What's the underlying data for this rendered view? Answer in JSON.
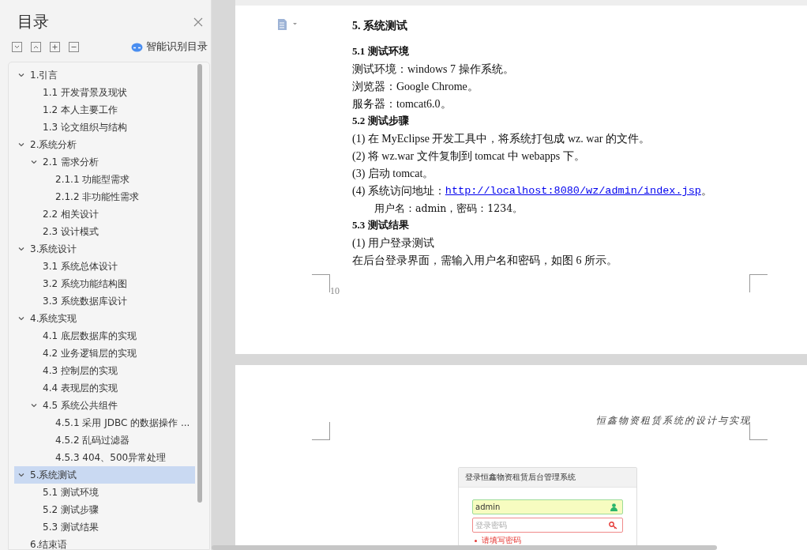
{
  "sidebar": {
    "title": "目录",
    "smart_toc": "智能识别目录",
    "tree": [
      {
        "label": "1.引言",
        "expanded": true,
        "selected": false,
        "children": [
          {
            "label": "1.1 开发背景及现状",
            "selected": false
          },
          {
            "label": "1.2 本人主要工作",
            "selected": false
          },
          {
            "label": "1.3 论文组织与结构",
            "selected": false
          }
        ]
      },
      {
        "label": "2.系统分析",
        "expanded": true,
        "selected": false,
        "children": [
          {
            "label": "2.1 需求分析",
            "expanded": true,
            "selected": false,
            "children": [
              {
                "label": "2.1.1 功能型需求",
                "selected": false
              },
              {
                "label": "2.1.2 非功能性需求",
                "selected": false
              }
            ]
          },
          {
            "label": "2.2 相关设计",
            "selected": false
          },
          {
            "label": "2.3 设计模式",
            "selected": false
          }
        ]
      },
      {
        "label": "3.系统设计",
        "expanded": true,
        "selected": false,
        "children": [
          {
            "label": "3.1 系统总体设计",
            "selected": false
          },
          {
            "label": "3.2 系统功能结构图",
            "selected": false
          },
          {
            "label": "3.3 系统数据库设计",
            "selected": false
          }
        ]
      },
      {
        "label": "4.系统实现",
        "expanded": true,
        "selected": false,
        "children": [
          {
            "label": "4.1 底层数据库的实现",
            "selected": false
          },
          {
            "label": "4.2 业务逻辑层的实现",
            "selected": false
          },
          {
            "label": "4.3 控制层的实现",
            "selected": false
          },
          {
            "label": "4.4 表现层的实现",
            "selected": false
          },
          {
            "label": "4.5 系统公共组件",
            "expanded": true,
            "selected": false,
            "children": [
              {
                "label": "4.5.1  采用 JDBC 的数据操作 ...",
                "selected": false
              },
              {
                "label": "4.5.2  乱码过滤器",
                "selected": false
              },
              {
                "label": "4.5.3 404、500异常处理",
                "selected": false
              }
            ]
          }
        ]
      },
      {
        "label": "5.系统测试",
        "expanded": true,
        "selected": true,
        "children": [
          {
            "label": "5.1 测试环境",
            "selected": false
          },
          {
            "label": "5.2 测试步骤",
            "selected": false
          },
          {
            "label": "5.3 测试结果",
            "selected": false
          }
        ]
      },
      {
        "label": "6.结束语",
        "selected": false
      }
    ]
  },
  "page1": {
    "lines": [
      {
        "kind": "h1",
        "text": "5. 系统测试"
      },
      {
        "kind": "h2",
        "text": "5.1 测试环境"
      },
      {
        "kind": "para",
        "text": "测试环境：windows 7 操作系统。"
      },
      {
        "kind": "para",
        "text": "浏览器：Google Chrome。"
      },
      {
        "kind": "para",
        "text": "服务器：tomcat6.0。"
      },
      {
        "kind": "h2",
        "text": "5.2 测试步骤"
      },
      {
        "kind": "para",
        "text": "(1)  在 MyEclipse 开发工具中，将系统打包成 wz. war 的文件。"
      },
      {
        "kind": "para",
        "text": "(2)  将 wz.war 文件复制到 tomcat 中 webapps 下。"
      },
      {
        "kind": "para",
        "text": "(3)  启动 tomcat。"
      },
      {
        "kind": "link",
        "text": "(4)  系统访问地址：",
        "link": "http://localhost:8080/wz/admin/index.jsp",
        "after": "。"
      },
      {
        "kind": "indent",
        "text": "用户名：admin，密码：1234。"
      },
      {
        "kind": "h2",
        "text": "5.3 测试结果"
      },
      {
        "kind": "para",
        "text": "(1)  用户登录测试"
      },
      {
        "kind": "para",
        "text": " 在后台登录界面，需输入用户名和密码，如图 6 所示。"
      }
    ],
    "page_number": "10"
  },
  "page2": {
    "header": "恒鑫物资租赁系统的设计与实现",
    "login": {
      "title": "登录恒鑫物资租赁后台管理系统",
      "username": "admin",
      "password_placeholder": "登录密码",
      "error": "请填写密码"
    }
  }
}
